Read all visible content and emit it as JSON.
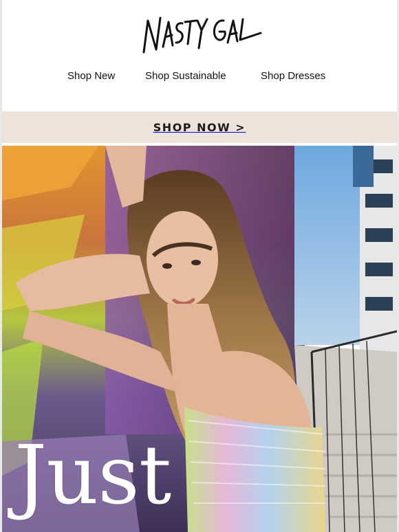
{
  "brand": {
    "logo_text": "NASTY GAL"
  },
  "nav": {
    "items": [
      {
        "label": "Shop New"
      },
      {
        "label": "Shop Sustainable"
      },
      {
        "label": "Shop Dresses"
      }
    ]
  },
  "banner": {
    "cta_label": "SHOP NOW >"
  },
  "hero": {
    "headline": "Just",
    "image_description_icon": "hero-photo"
  },
  "colors": {
    "banner_bg": "#ede3da",
    "text": "#111111",
    "headline": "#ffffff"
  }
}
